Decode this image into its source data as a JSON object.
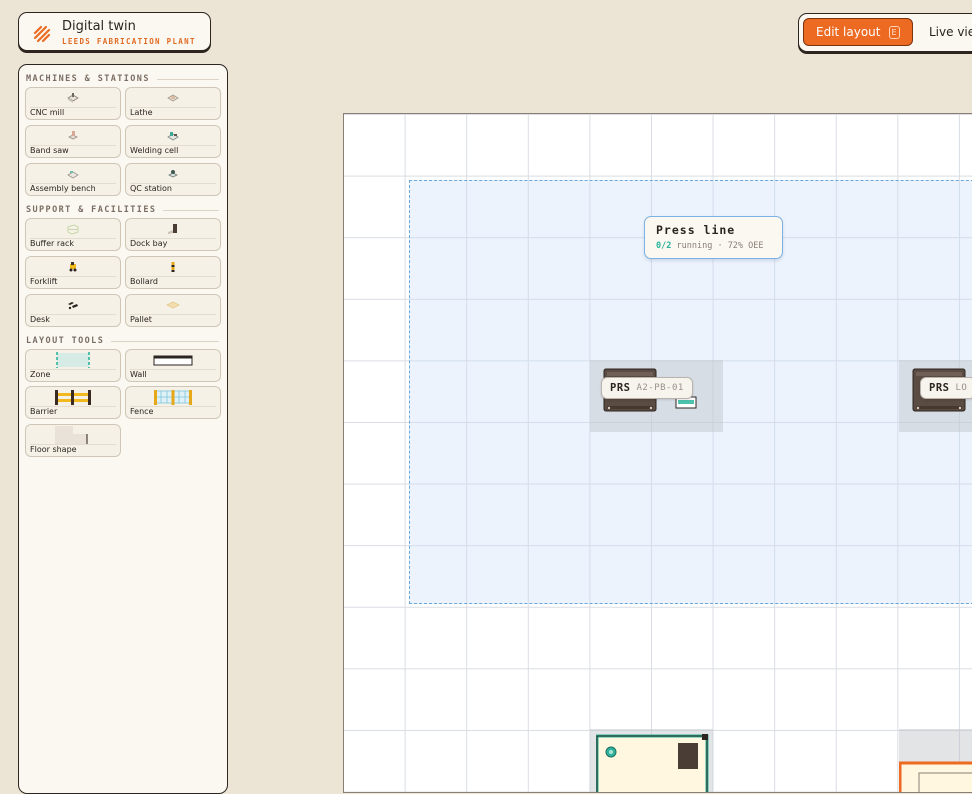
{
  "brand": {
    "title": "Digital twin",
    "subtitle": "LEEDS FABRICATION PLANT"
  },
  "modes": {
    "edit_label": "Edit layout",
    "edit_shortcut": "E",
    "live_label": "Live view"
  },
  "palette": {
    "sections": [
      {
        "title": "MACHINES & STATIONS",
        "items": [
          {
            "label": "CNC mill",
            "icon": "cnc-mill-icon"
          },
          {
            "label": "Lathe",
            "icon": "lathe-icon"
          },
          {
            "label": "Band saw",
            "icon": "band-saw-icon"
          },
          {
            "label": "Welding cell",
            "icon": "welding-cell-icon"
          },
          {
            "label": "Assembly bench",
            "icon": "assembly-bench-icon"
          },
          {
            "label": "QC station",
            "icon": "qc-station-icon"
          }
        ]
      },
      {
        "title": "SUPPORT & FACILITIES",
        "items": [
          {
            "label": "Buffer rack",
            "icon": "buffer-rack-icon"
          },
          {
            "label": "Dock bay",
            "icon": "dock-bay-icon"
          },
          {
            "label": "Forklift",
            "icon": "forklift-icon"
          },
          {
            "label": "Bollard",
            "icon": "bollard-icon"
          },
          {
            "label": "Desk",
            "icon": "desk-icon"
          },
          {
            "label": "Pallet",
            "icon": "pallet-icon"
          }
        ]
      },
      {
        "title": "LAYOUT TOOLS",
        "items": [
          {
            "label": "Zone",
            "icon": "zone-icon"
          },
          {
            "label": "Wall",
            "icon": "wall-icon"
          },
          {
            "label": "Barrier",
            "icon": "barrier-icon"
          },
          {
            "label": "Fence",
            "icon": "fence-icon"
          },
          {
            "label": "Floor shape",
            "icon": "floor-shape-icon"
          }
        ]
      }
    ]
  },
  "floor": {
    "zone": {
      "name": "Press line",
      "running": "0/2",
      "running_label": "running",
      "oee": "72% OEE",
      "color": "#6aa6dc"
    },
    "stations": [
      {
        "code": "PRS",
        "id": "A2-PB-01"
      },
      {
        "code": "PRS",
        "id": "LO"
      }
    ]
  },
  "colors": {
    "accent": "#ec6a22",
    "zone": "#6aa6dc",
    "running": "#27b39a",
    "ink": "#2e2520"
  }
}
